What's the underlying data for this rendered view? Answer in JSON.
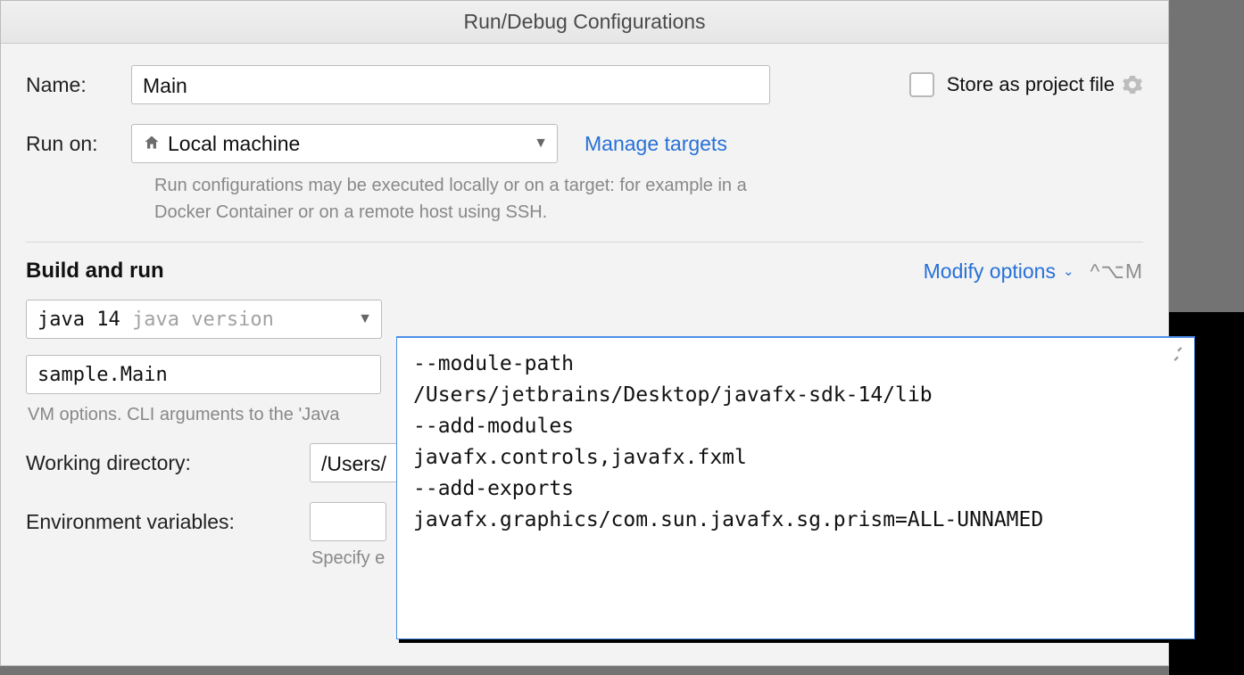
{
  "title": "Run/Debug Configurations",
  "name": {
    "label": "Name:",
    "value": "Main"
  },
  "store_as_project": {
    "label": "Store as project file",
    "checked": false
  },
  "run_on": {
    "label": "Run on:",
    "selected": "Local machine",
    "manage_link": "Manage targets"
  },
  "run_on_help": "Run configurations may be executed locally or on a target: for example in a Docker Container or on a remote host using SSH.",
  "build_run": {
    "title": "Build and run",
    "modify": "Modify options",
    "shortcut": "^⌥M",
    "jdk_name": "java 14",
    "jdk_hint": "java version",
    "main_class": "sample.Main",
    "vm_help": "VM options. CLI arguments to the 'Java",
    "workdir_label": "Working directory:",
    "workdir_value": "/Users/",
    "env_label": "Environment variables:",
    "env_help": "Specify e"
  },
  "vm_popup": "--module-path\n/Users/jetbrains/Desktop/javafx-sdk-14/lib\n--add-modules\njavafx.controls,javafx.fxml\n--add-exports\njavafx.graphics/com.sun.javafx.sg.prism=ALL-UNNAMED"
}
